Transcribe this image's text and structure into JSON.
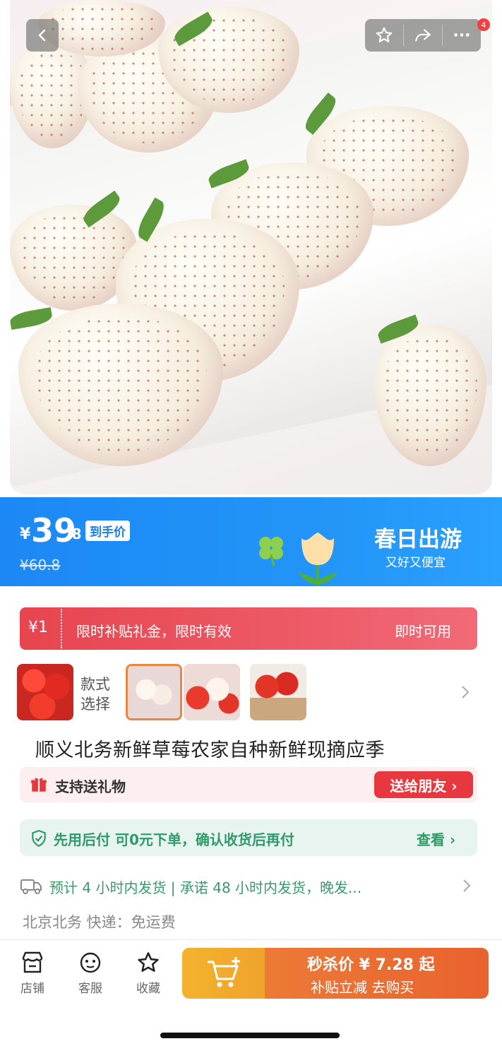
{
  "hero": {
    "badge_count": "4"
  },
  "price": {
    "currency": "¥",
    "integer": "39",
    "decimal": ".8",
    "tag": "到手价",
    "original": "¥60.8"
  },
  "promo": {
    "title": "春日出游",
    "subtitle": "又好又便宜"
  },
  "coupon": {
    "amount": "¥1",
    "text": "限时补贴礼金，限时有效",
    "action": "即时可用"
  },
  "style_selector": {
    "label": "款式\n选择",
    "options": [
      {
        "name": "red",
        "selected": false
      },
      {
        "name": "white",
        "selected": true
      },
      {
        "name": "mixed",
        "selected": false
      },
      {
        "name": "basket",
        "selected": false
      }
    ]
  },
  "product": {
    "title": "顺义北务新鲜草莓农家自种新鲜现摘应季"
  },
  "gift": {
    "text": "支持送礼物",
    "button": "送给朋友 ›"
  },
  "payment": {
    "text": "先用后付 可0元下单，确认收货后再付",
    "action": "查看 ›"
  },
  "shipping": {
    "text": "预计 4 小时内发货 | 承诺 48 小时内发货，晚发...",
    "location": "北京北务 快递：免运费"
  },
  "bottom_nav": {
    "shop": "店铺",
    "service": "客服",
    "favorite": "收藏"
  },
  "cta": {
    "main": "秒杀价 ¥ 7.28 起",
    "sub": "补贴立减 去购买"
  },
  "colors": {
    "banner_blue": "#1c88f5",
    "coupon_red": "#e7454f",
    "pay_green": "#2f9a6a",
    "cta_orange": "#e9622f",
    "cta_yellow": "#f3b22e"
  }
}
